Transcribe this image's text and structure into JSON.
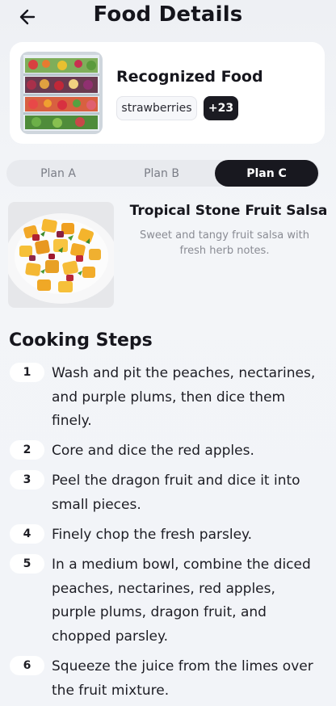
{
  "header": {
    "title": "Food Details",
    "back_icon": "arrow-left-icon"
  },
  "recognized": {
    "title": "Recognized Food",
    "tag": "strawberries",
    "more_count": "+23"
  },
  "plans": {
    "items": [
      "Plan A",
      "Plan B",
      "Plan C"
    ],
    "selected": "Plan C"
  },
  "dish": {
    "title": "Tropical Stone Fruit Salsa",
    "description": "Sweet and tangy fruit salsa with fresh herb notes."
  },
  "steps": {
    "heading": "Cooking Steps",
    "items": [
      {
        "num": "1",
        "text": "Wash and pit the peaches, nectarines, and purple plums, then dice them finely."
      },
      {
        "num": "2",
        "text": "Core and dice the red apples."
      },
      {
        "num": "3",
        "text": "Peel the dragon fruit and dice it into small pieces."
      },
      {
        "num": "4",
        "text": "Finely chop the fresh parsley."
      },
      {
        "num": "5",
        "text": "In a medium bowl, combine the diced peaches, nectarines, red apples, purple plums, dragon fruit, and chopped parsley."
      },
      {
        "num": "6",
        "text": "Squeeze the juice from the limes over the fruit mixture."
      }
    ]
  },
  "colors": {
    "accent": "#18181f",
    "background": "#f2f4f8",
    "card": "#ffffff",
    "muted_text": "#8a8c94"
  }
}
